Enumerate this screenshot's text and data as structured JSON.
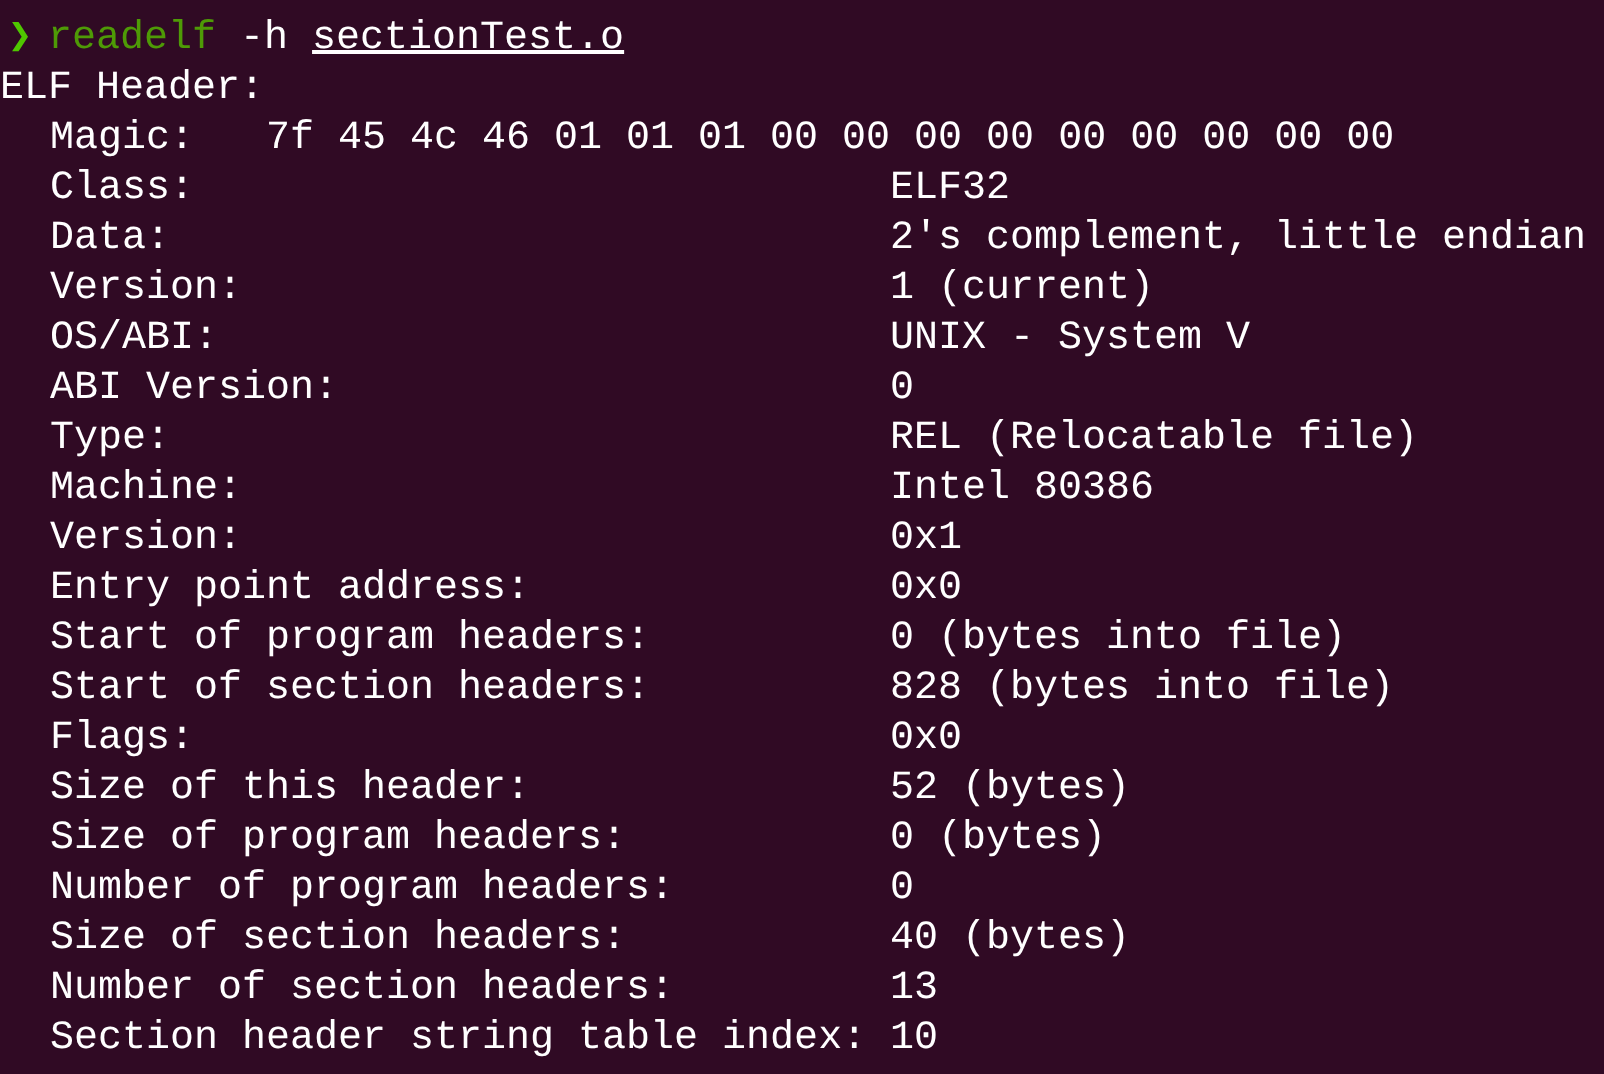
{
  "prompt": {
    "symbol": "❯",
    "command": "readelf",
    "args": "-h",
    "file": "sectionTest.o"
  },
  "header": "ELF Header:",
  "magic": {
    "label": "Magic:",
    "value": "7f 45 4c 46 01 01 01 00 00 00 00 00 00 00 00 00"
  },
  "fields": [
    {
      "label": "Class:",
      "value": "ELF32"
    },
    {
      "label": "Data:",
      "value": "2's complement, little endian"
    },
    {
      "label": "Version:",
      "value": "1 (current)"
    },
    {
      "label": "OS/ABI:",
      "value": "UNIX - System V"
    },
    {
      "label": "ABI Version:",
      "value": "0"
    },
    {
      "label": "Type:",
      "value": "REL (Relocatable file)"
    },
    {
      "label": "Machine:",
      "value": "Intel 80386"
    },
    {
      "label": "Version:",
      "value": "0x1"
    },
    {
      "label": "Entry point address:",
      "value": "0x0"
    },
    {
      "label": "Start of program headers:",
      "value": "0 (bytes into file)"
    },
    {
      "label": "Start of section headers:",
      "value": "828 (bytes into file)"
    },
    {
      "label": "Flags:",
      "value": "0x0"
    },
    {
      "label": "Size of this header:",
      "value": "52 (bytes)"
    },
    {
      "label": "Size of program headers:",
      "value": "0 (bytes)"
    },
    {
      "label": "Number of program headers:",
      "value": "0"
    },
    {
      "label": "Size of section headers:",
      "value": "40 (bytes)"
    },
    {
      "label": "Number of section headers:",
      "value": "13"
    },
    {
      "label": "Section header string table index:",
      "value": "10"
    }
  ]
}
